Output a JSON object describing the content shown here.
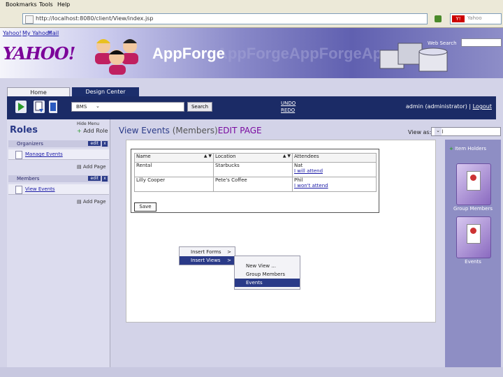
{
  "browser": {
    "menu": [
      "Bookmarks",
      "Tools",
      "Help"
    ],
    "url": "http://localhost:8080/client/View/index.jsp",
    "search_placeholder": "Yahoo"
  },
  "banner": {
    "yahoo_links": [
      "Yahoo!",
      "My Yahoo!",
      "Mail"
    ],
    "yahoo_logo": "YAHOO!",
    "app_title": "AppForge",
    "app_title_ghost": "AppForgeAppForgeApp",
    "web_search_label": "Web Search"
  },
  "tabs": {
    "home": "Home",
    "design": "Design Center"
  },
  "toolbar": {
    "project": "BMS",
    "search": "Search",
    "undo": "UNDO",
    "redo": "REDO",
    "user": "admin (administrator) |",
    "logout": "Logout"
  },
  "left": {
    "title": "Roles",
    "hide_menu": "Hide Menu",
    "add_role": "Add Role",
    "roles": [
      {
        "name": "Organizers",
        "edit": "edit",
        "x": "x",
        "page": "Manage Events",
        "add_page": "Add Page"
      },
      {
        "name": "Members",
        "edit": "edit",
        "x": "x",
        "page": "View Events",
        "add_page": "Add Page"
      }
    ]
  },
  "main": {
    "title_a": "View Events ",
    "title_b": "(Members)",
    "title_c": "EDIT PAGE",
    "view_as_label": "View as:",
    "view_as_value": "Phil"
  },
  "table": {
    "headers": [
      "Name",
      "Location",
      "Attendees"
    ],
    "rows": [
      {
        "name": "Rental",
        "location": "Starbucks",
        "att": "Nat",
        "link": "I will attend"
      },
      {
        "name": "Lilly Cooper",
        "location": "Pete's Coffee",
        "att": "Phil",
        "link": "I won't attend"
      }
    ],
    "save": "Save"
  },
  "menu1": {
    "items": [
      "Insert Forms",
      "Insert Views"
    ],
    "arrow": ">"
  },
  "menu2": {
    "items": [
      "New View ...",
      "Group Members",
      "Events"
    ]
  },
  "right": {
    "title": "Item Holders",
    "folders": [
      "Group Members",
      "Events"
    ]
  },
  "colors": {
    "toolbar": "#1b2b66",
    "accent": "#2a3a88",
    "panel": "#8e8ec4"
  }
}
